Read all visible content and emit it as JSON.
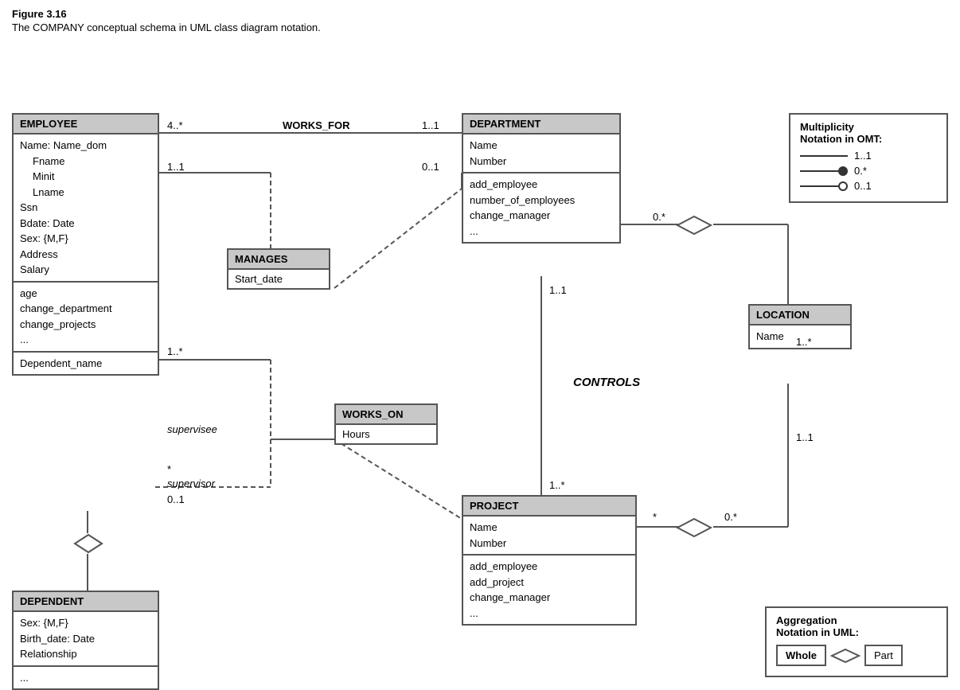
{
  "figure": {
    "title": "Figure 3.16",
    "caption": "The COMPANY conceptual schema in UML class diagram notation."
  },
  "classes": {
    "employee": {
      "header": "EMPLOYEE",
      "section1": [
        "Name: Name_dom",
        "    Fname",
        "    Minit",
        "    Lname",
        "Ssn",
        "Bdate: Date",
        "Sex: {M,F}",
        "Address",
        "Salary"
      ],
      "section2": [
        "age",
        "change_department",
        "change_projects",
        "..."
      ],
      "section3": [
        "Dependent_name"
      ]
    },
    "department": {
      "header": "DEPARTMENT",
      "section1": [
        "Name",
        "Number"
      ],
      "section2": [
        "add_employee",
        "number_of_employees",
        "change_manager",
        "..."
      ]
    },
    "project": {
      "header": "PROJECT",
      "section1": [
        "Name",
        "Number"
      ],
      "section2": [
        "add_employee",
        "add_project",
        "change_manager",
        "..."
      ]
    },
    "dependent": {
      "header": "DEPENDENT",
      "section1": [
        "Sex: {M,F}",
        "Birth_date: Date",
        "Relationship"
      ],
      "section2": [
        "..."
      ]
    },
    "location": {
      "header": "LOCATION",
      "section1": [
        "Name"
      ]
    }
  },
  "associations": {
    "manages": {
      "header": "MANAGES",
      "section1": [
        "Start_date"
      ]
    },
    "works_on": {
      "header": "WORKS_ON",
      "section1": [
        "Hours"
      ]
    }
  },
  "labels": {
    "works_for": "WORKS_FOR",
    "controls": "CONTROLS",
    "supervisee": "supervisee",
    "supervisor": "supervisor",
    "works_for_mult1": "4..*",
    "works_for_mult2": "1..1",
    "manages_mult1": "1..1",
    "manages_mult2": "0..1",
    "supervise_mult1": "1..*",
    "supervise_mult2": "*",
    "supervise_mult3": "0..1",
    "dept_project_mult1": "1..1",
    "dept_project_mult2": "1..*",
    "project_loc_mult1": "*",
    "project_loc_mult2": "0.*",
    "dept_loc_mult1": "0.*",
    "dept_loc_mult2": "1..*",
    "loc_mult": "1..1"
  },
  "notation": {
    "title1": "Multiplicity",
    "title2": "Notation in OMT:",
    "row1_label": "1..1",
    "row2_label": "0.*",
    "row3_label": "0..1"
  },
  "aggregation": {
    "title1": "Aggregation",
    "title2": "Notation in UML:",
    "whole_label": "Whole",
    "part_label": "Part"
  }
}
